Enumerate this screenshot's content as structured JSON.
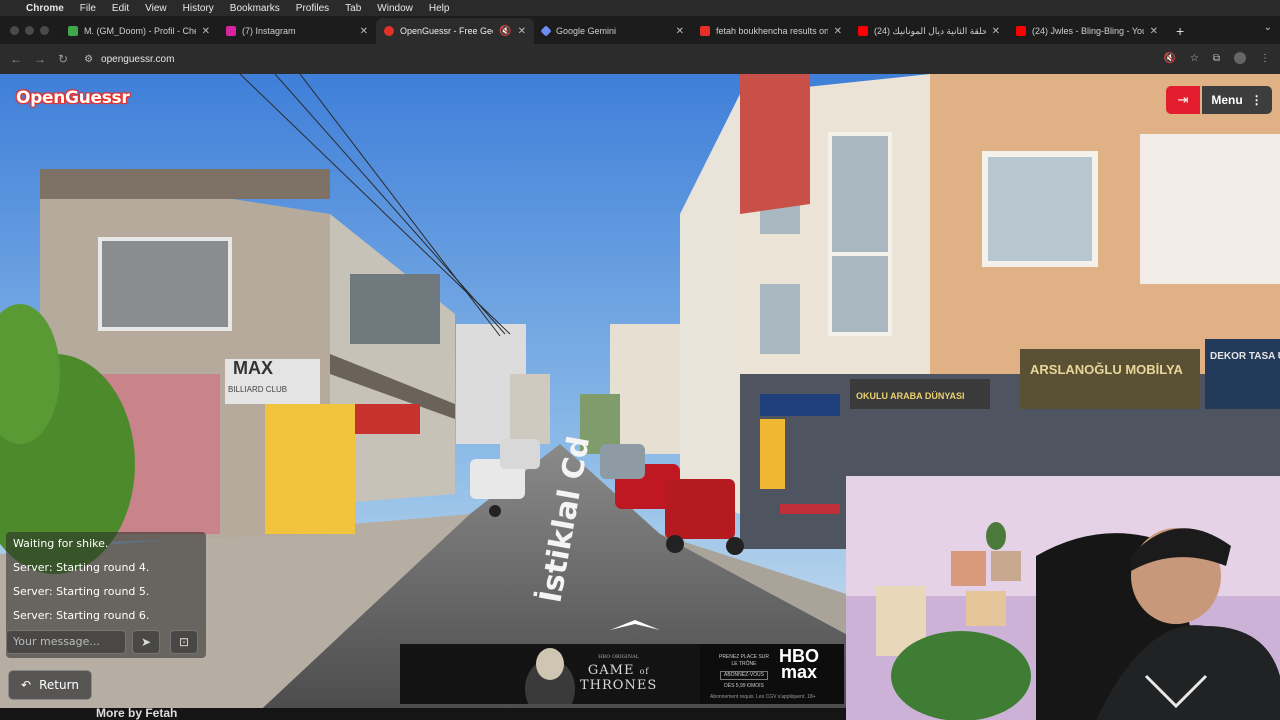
{
  "menubar": {
    "app_name": "Chrome",
    "items": [
      "File",
      "Edit",
      "View",
      "History",
      "Bookmarks",
      "Profiles",
      "Tab",
      "Window",
      "Help"
    ]
  },
  "tabs": [
    {
      "title": "M. (GM_Doom) - Profil - Che",
      "favicon_color": "#3fa64a",
      "active": false
    },
    {
      "title": "(7) Instagram",
      "favicon_color": "#d6249f",
      "active": false
    },
    {
      "title": "OpenGuessr - Free GeoG",
      "favicon_color": "#e5302a",
      "active": true
    },
    {
      "title": "Google Gemini",
      "favicon_color": "#6b8ef5",
      "active": false
    },
    {
      "title": "fetah boukhencha results on",
      "favicon_color": "#e5302a",
      "active": false
    },
    {
      "title": "(24) الحلقة الثانية ديال المونانيك",
      "favicon_color": "#ff0000",
      "active": false
    },
    {
      "title": "(24) Jwles - Bling-Bling - You",
      "favicon_color": "#ff0000",
      "active": false
    }
  ],
  "toolbar": {
    "url": "openguessr.com"
  },
  "game": {
    "logo": "OpenGuessr",
    "menu_label": "Menu",
    "street_label": "İstiklal Cd",
    "chat": {
      "messages": [
        "Waiting for shike.",
        "Server: Starting round 4.",
        "Server: Starting round 5.",
        "Server: Starting round 6."
      ],
      "input_placeholder": "Your message..."
    },
    "return_label": "Return",
    "signs": {
      "billiard": "MAX",
      "billiard_sub": "BILLIARD CLUB",
      "furniture": "ARSLANOĞLU MOBİLYA",
      "car_dunyasi": "OKULU ARABA DÜNYASI",
      "dekor": "DEKOR TASA UYGU"
    }
  },
  "ad": {
    "show_top": "HBO ORIGINAL",
    "show_title_1": "GAME",
    "show_title_2": "of",
    "show_title_3": "THRONES",
    "tagline": "PRENEZ PLACE SUR LE TRÔNE",
    "cta": "ABONNEZ-VOUS",
    "price": "DÈS 5,99 €/MOIS",
    "brand_1": "HBO",
    "brand_2": "max",
    "fine_print": "Abonnement requis. Les CGV s'appliquent. 18+"
  },
  "bottom_text": "More by Fetah",
  "colors": {
    "brand_red": "#e5302a",
    "exit_red": "#e11d2e"
  }
}
